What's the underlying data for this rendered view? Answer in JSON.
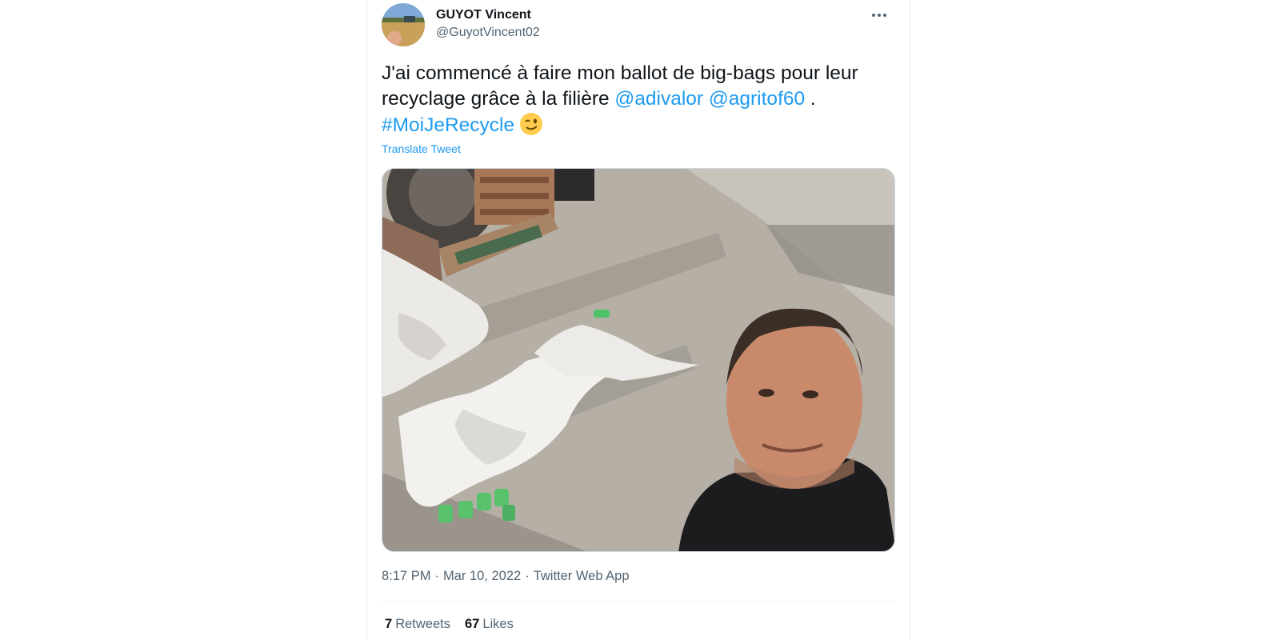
{
  "tweet": {
    "author": {
      "name": "GUYOT Vincent",
      "handle": "@GuyotVincent02"
    },
    "text": {
      "line1": "J'ai commencé à faire mon ballot de big-bags pour leur recyclage grâce à la filière ",
      "mention1": "@adivalor",
      "mention2": "@agritof60",
      "period": " .",
      "hashtag": "#MoiJeRecycle",
      "emoji": "winking-face-emoji"
    },
    "translate_label": "Translate Tweet",
    "meta": {
      "time": "8:17 PM",
      "date": "Mar 10, 2022",
      "separator": "·",
      "app": "Twitter Web App"
    },
    "stats": {
      "retweets_count": "7",
      "retweets_label": "Retweets",
      "likes_count": "67",
      "likes_label": "Likes"
    }
  },
  "icons": {
    "more": "more-horizontal-icon"
  },
  "colors": {
    "link": "#1d9bf0",
    "secondary_text": "#536471",
    "primary_text": "#0f1419"
  }
}
